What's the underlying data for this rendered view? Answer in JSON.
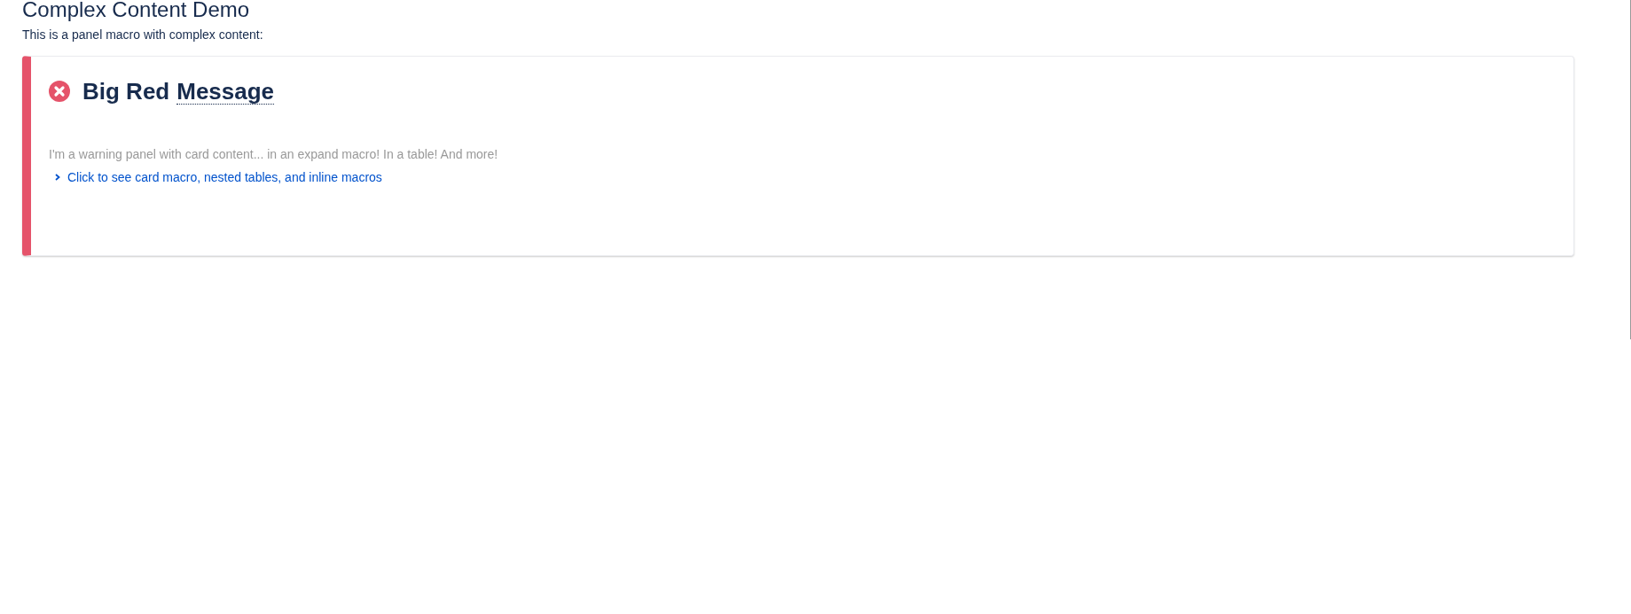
{
  "page": {
    "heading": "Complex Content Demo",
    "intro": "This is a panel macro with complex content:"
  },
  "panel": {
    "color": "#e5536a",
    "title": "Big Red",
    "title_abbr": "Message",
    "body": "I'm a warning panel with card content... in an expand macro! In a table! And more!",
    "expand": {
      "label": "Click to see card macro, nested tables, and inline macros",
      "expanded": false
    }
  }
}
